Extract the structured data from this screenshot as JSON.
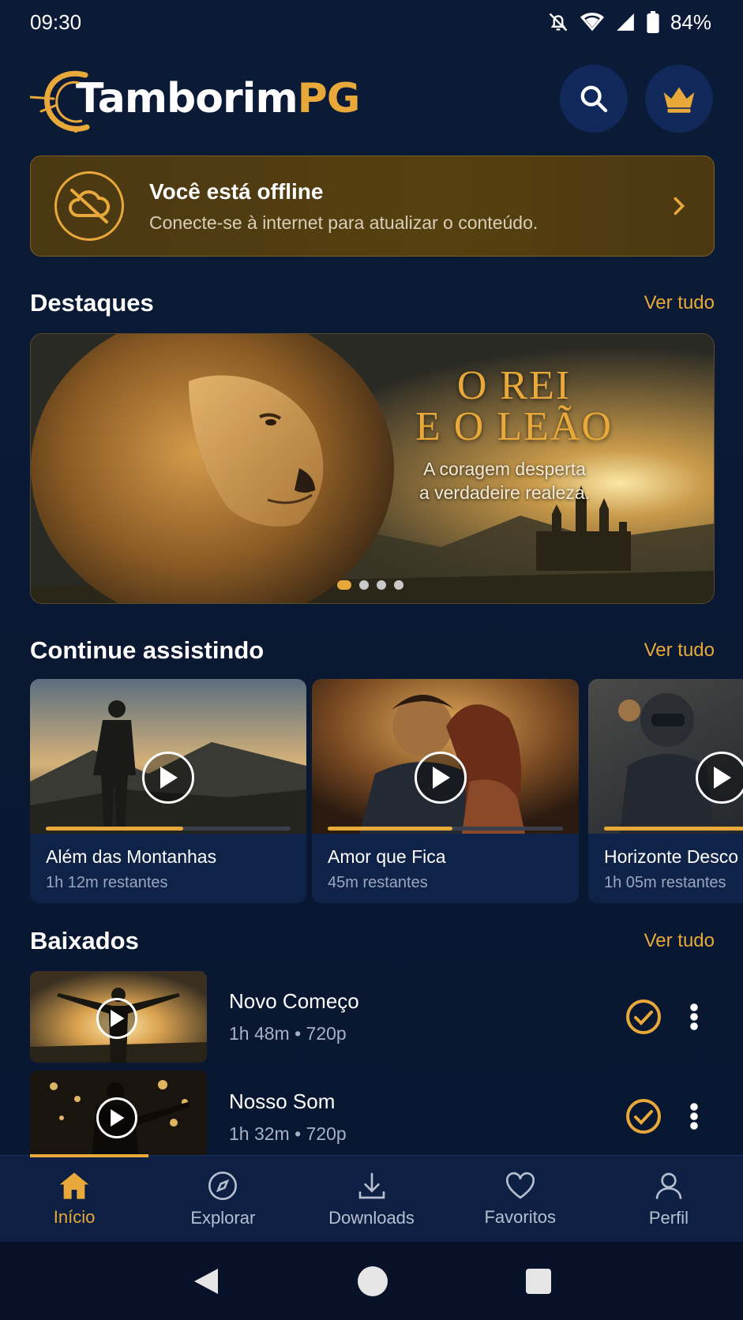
{
  "status": {
    "time": "09:30",
    "battery": "84%"
  },
  "header": {
    "brand_main": "Tamborim",
    "brand_accent": "PG"
  },
  "offline": {
    "title": "Você está offline",
    "subtitle": "Conecte-se à internet para atualizar o conteúdo."
  },
  "highlights": {
    "title": "Destaques",
    "see_all": "Ver tudo",
    "hero_title_line1": "O REI",
    "hero_title_line2": "E O LEÃO",
    "hero_subtitle_line1": "A coragem desperta",
    "hero_subtitle_line2": "a verdadeire realeza.",
    "slide_count": 4,
    "active_slide": 1
  },
  "continue_watching": {
    "title": "Continue assistindo",
    "see_all": "Ver tudo",
    "items": [
      {
        "title": "Além das Montanhas",
        "remaining": "1h 12m restantes",
        "progress": 0.56
      },
      {
        "title": "Amor que Fica",
        "remaining": "45m restantes",
        "progress": 0.53
      },
      {
        "title": "Horizonte Desco",
        "remaining": "1h 05m restantes",
        "progress": 0.7
      }
    ]
  },
  "downloads": {
    "title": "Baixados",
    "see_all": "Ver tudo",
    "items": [
      {
        "title": "Novo Começo",
        "meta": "1h 48m • 720p"
      },
      {
        "title": "Nosso Som",
        "meta": "1h 32m • 720p"
      }
    ]
  },
  "bottom_nav": {
    "items": [
      {
        "label": "Início",
        "icon": "home-icon",
        "active": true
      },
      {
        "label": "Explorar",
        "icon": "compass-icon",
        "active": false
      },
      {
        "label": "Downloads",
        "icon": "download-icon",
        "active": false
      },
      {
        "label": "Favoritos",
        "icon": "heart-icon",
        "active": false
      },
      {
        "label": "Perfil",
        "icon": "user-icon",
        "active": false
      }
    ]
  },
  "colors": {
    "accent": "#e8a93a",
    "background": "#0a1933",
    "nav_bg": "#0d1f42"
  }
}
